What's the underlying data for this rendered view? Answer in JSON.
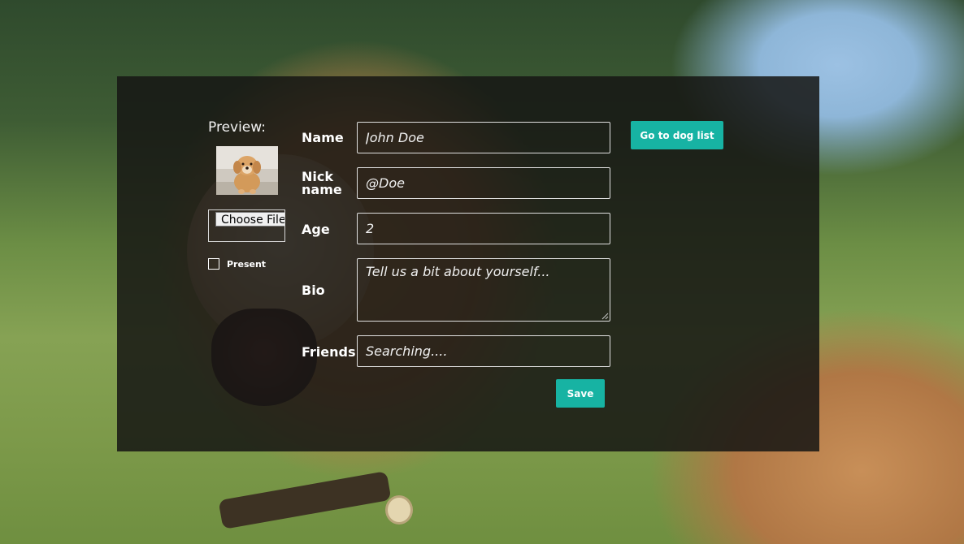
{
  "preview": {
    "label": "Preview:"
  },
  "file_input": {
    "button_label": "Choose File"
  },
  "present": {
    "label": "Present",
    "checked": false
  },
  "fields": {
    "name": {
      "label": "Name",
      "placeholder": "John Doe"
    },
    "nickname": {
      "label_line1": "Nick",
      "label_line2": "name",
      "placeholder": "@Doe"
    },
    "age": {
      "label": "Age",
      "placeholder": "2"
    },
    "bio": {
      "label": "Bio",
      "placeholder": "Tell us a bit about yourself..."
    },
    "friends": {
      "label": "Friends",
      "placeholder": "Searching...."
    }
  },
  "buttons": {
    "dog_list": "Go to dog list",
    "save": "Save"
  },
  "colors": {
    "accent": "#17b3a3",
    "overlay": "#161614"
  },
  "icons": {
    "preview_image": "dog-photo-thumbnail",
    "background": "golden-retriever-photo"
  }
}
